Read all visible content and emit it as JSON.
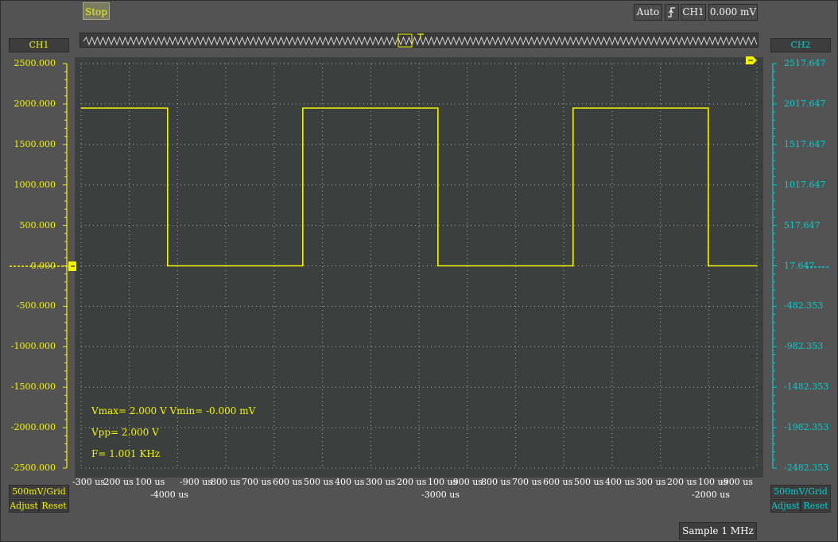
{
  "toolbar": {
    "stop_label": "Stop",
    "trigger_mode": "Auto",
    "trigger_edge_icon": "rising-edge-icon",
    "trigger_channel": "CH1",
    "trigger_level": "0.000 mV"
  },
  "ch1": {
    "name": "CH1",
    "color": "#f4f400",
    "scale_labels": [
      "2500.000",
      "2000.000",
      "1500.000",
      "1000.000",
      "500.000",
      "0.000",
      "-500.000",
      "-1000.000",
      "-1500.000",
      "-2000.000",
      "-2500.000"
    ],
    "volts_per_div": "500mV/Grid",
    "adjust_label": "Adjust",
    "reset_label": "Reset"
  },
  "ch2": {
    "name": "CH2",
    "color": "#00d0d0",
    "scale_labels": [
      "2517.647",
      "2017.647",
      "1517.647",
      "1017.647",
      "517.647",
      "17.647",
      "-482.353",
      "-982.353",
      "-1482.353",
      "-1982.353",
      "-2482.353"
    ],
    "volts_per_div": "500mV/Grid",
    "adjust_label": "Adjust",
    "reset_label": "Reset"
  },
  "time_axis": {
    "upper_labels": [
      "-300 us",
      "200 us",
      "100 us",
      "-900 us",
      "800 us",
      "700 us",
      "600 us",
      "500 us",
      "400 us",
      "300 us",
      "200 us",
      "100 us",
      "-900 us",
      "800 us",
      "700 us",
      "600 us",
      "500 us",
      "400 us",
      "300 us",
      "200 us",
      "100 us",
      "-900 us"
    ],
    "major_labels": [
      "-4000 us",
      "-3000 us",
      "-2000 us"
    ]
  },
  "measurements": {
    "vmax_vmin": "Vmax= 2.000 V  Vmin= -0.000 mV",
    "vpp": "Vpp= 2.000 V",
    "freq": "F= 1.001 KHz"
  },
  "sample_rate": "Sample 1 MHz",
  "chart_data": {
    "type": "line",
    "series": [
      {
        "name": "CH1",
        "x_us": [
          -4330,
          -4010,
          -4010,
          -3510,
          -3510,
          -3010,
          -3010,
          -2510,
          -2510,
          -2010,
          -2010,
          -1830
        ],
        "y_mV": [
          1950,
          1950,
          0,
          0,
          1950,
          1950,
          0,
          0,
          1950,
          1950,
          0,
          0
        ]
      }
    ],
    "xlim_us": [
      -4330,
      -1830
    ],
    "ylim_mV": [
      -2500,
      2500
    ],
    "grid": true
  }
}
